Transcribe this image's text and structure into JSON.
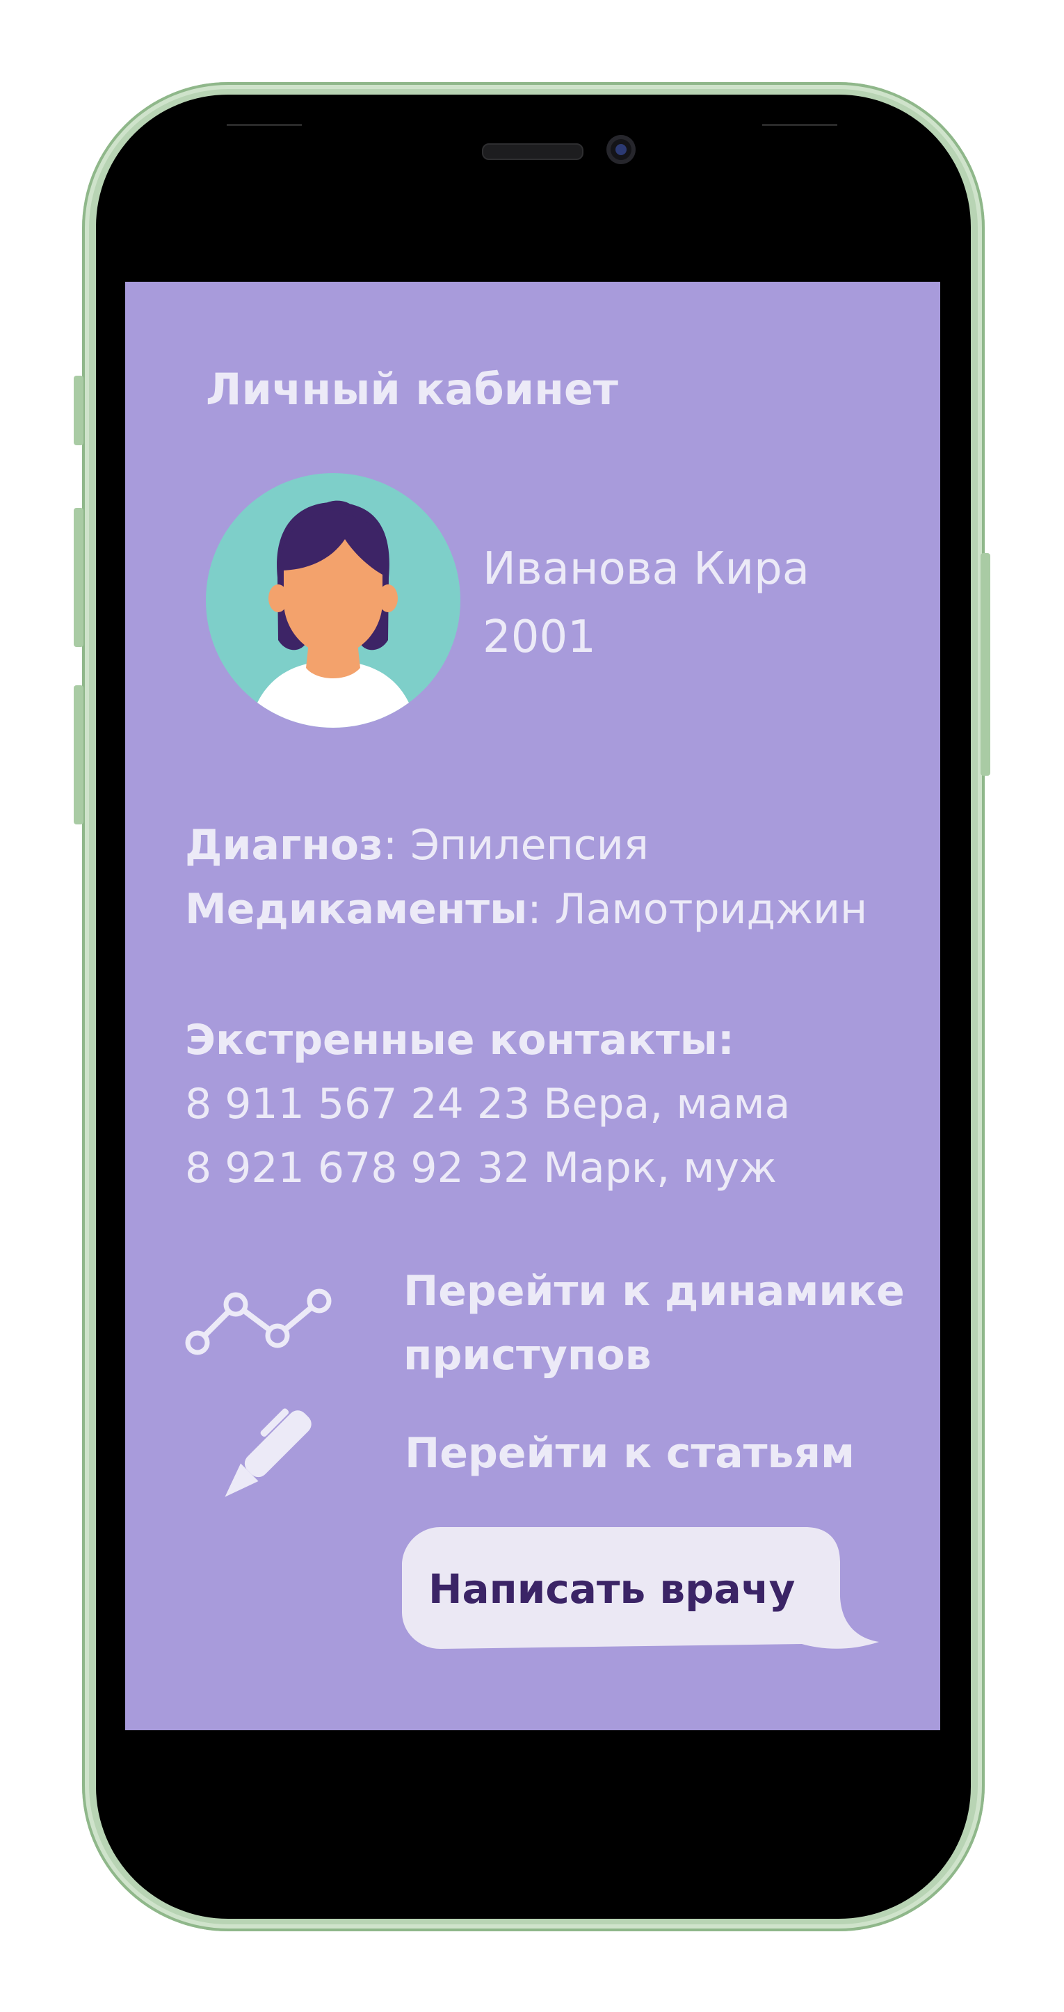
{
  "colors": {
    "screen_background": "#a89bdb",
    "text_light": "#eceaf7",
    "accent_dark": "#3b2466",
    "avatar_circle": "#7ecfc9",
    "bubble": "#ebe8f4",
    "phone_frame": "#b8d4b4"
  },
  "header": {
    "title": "Личный кабинет"
  },
  "profile": {
    "name": "Иванова Кира",
    "year": "2001",
    "avatar_icon": "woman-avatar-icon"
  },
  "medical": {
    "diagnosis_label": "Диагноз",
    "diagnosis_value": ": Эпилепсия",
    "medication_label": "Медикаменты",
    "medication_value": ": Ламотриджин"
  },
  "emergency": {
    "title": "Экстренные контакты:",
    "contacts": [
      "8 911 567 24 23 Вера, мама",
      "8 921 678 92 32 Марк, муж"
    ]
  },
  "links": {
    "dynamics_line1": "Перейти к динамике",
    "dynamics_line2": "приступов",
    "dynamics_icon": "line-chart-icon",
    "articles": "Перейти к статьям",
    "articles_icon": "pen-icon"
  },
  "chat": {
    "label": "Написать врачу",
    "icon": "speech-bubble-icon"
  }
}
